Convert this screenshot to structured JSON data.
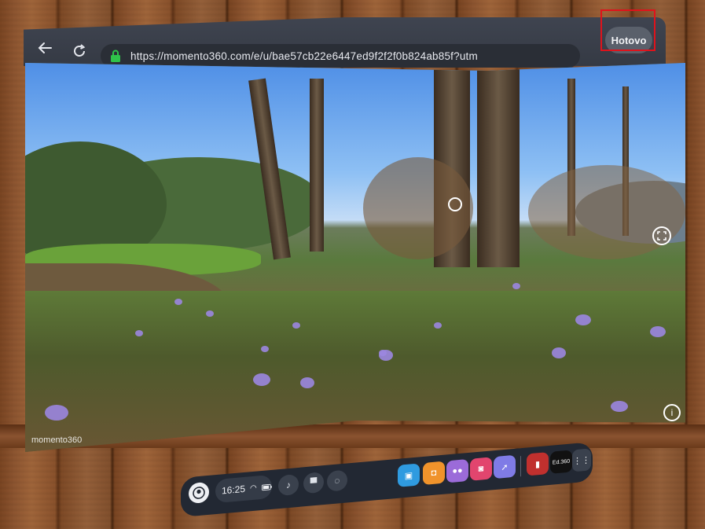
{
  "browser": {
    "back_icon": "arrow-left-icon",
    "reload_icon": "reload-icon",
    "lock_icon": "lock-icon",
    "url": "https://momento360.com/e/u/bae57cb22e6447ed9f2f2f0b824ab85f?utm",
    "done_label": "Hotovo"
  },
  "panorama": {
    "watermark": "momento360",
    "center_icon": "circle-cursor-icon",
    "fullscreen_icon": "fullscreen-icon",
    "info_icon": "info-icon"
  },
  "dock": {
    "avatar_icon": "avatar-icon",
    "time": "16:25",
    "wifi_icon": "wifi-icon",
    "battery_icon": "battery-icon",
    "apps": [
      {
        "name": "store-icon",
        "color": "#2f9be0"
      },
      {
        "name": "shop-icon",
        "color": "#f0932b"
      },
      {
        "name": "people-icon",
        "color": "#9b6bd9"
      },
      {
        "name": "camera-icon",
        "color": "#e2456e"
      },
      {
        "name": "browser-icon",
        "color": "#7f7be6"
      }
    ],
    "recent_app_label": "Ed.360",
    "grid_icon": "apps-grid-icon"
  },
  "colors": {
    "toolbar": "#3f4450",
    "highlight": "#e0121b"
  }
}
